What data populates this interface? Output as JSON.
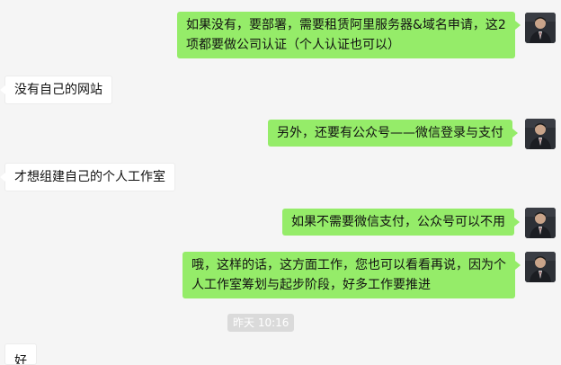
{
  "messages": [
    {
      "side": "right",
      "text": "如果没有，要部署，需要租赁阿里服务器&域名申请，这2项都要做公司认证（个人认证也可以）"
    },
    {
      "side": "left",
      "text": "没有自己的网站"
    },
    {
      "side": "right",
      "text": "另外，还要有公众号——微信登录与支付"
    },
    {
      "side": "left",
      "text": "才想组建自己的个人工作室"
    },
    {
      "side": "right",
      "text": "如果不需要微信支付，公众号可以不用"
    },
    {
      "side": "right",
      "text": "哦，这样的话，这方面工作，您也可以看看再说，因为个人工作室筹划与起步阶段，好多工作要推进"
    },
    {
      "side": "left",
      "text": "好"
    }
  ],
  "timestamp": "昨天 10:16",
  "avatar_icon": "user-avatar-icon",
  "colors": {
    "background": "#f5f5f5",
    "sent_bubble": "#95ec69",
    "received_bubble": "#ffffff",
    "timestamp_bg": "#dadada"
  }
}
